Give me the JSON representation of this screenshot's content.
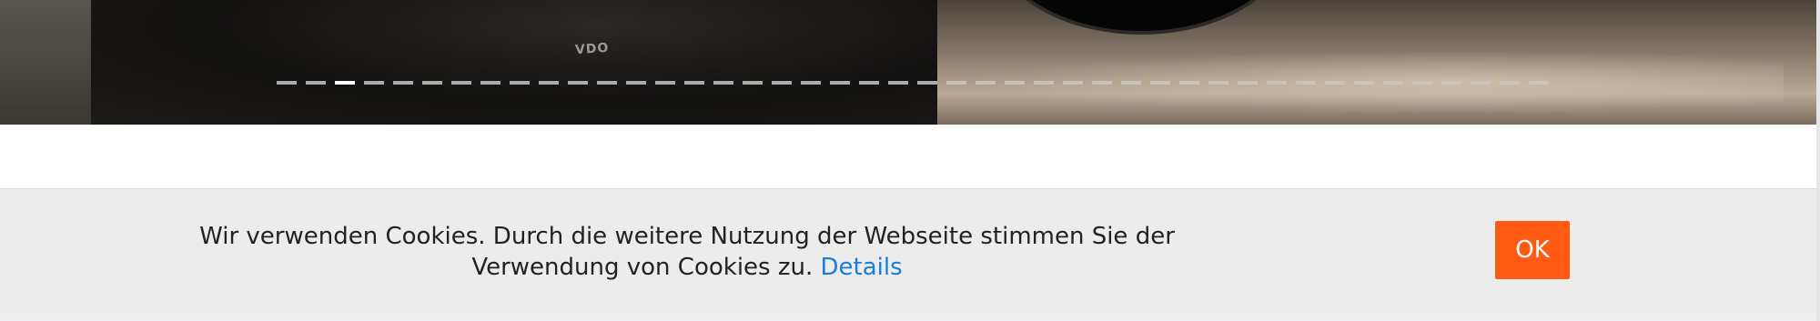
{
  "hero": {
    "logo_text": "VDO",
    "slider": {
      "dot_count": 44,
      "active_index": 2,
      "dot_color": "#c7c7c7",
      "active_color": "#ffffff"
    }
  },
  "cookie_banner": {
    "message": "Wir verwenden Cookies. Durch die weitere Nutzung der Webseite stimmen Sie der Verwendung von Cookies zu.",
    "details_link": "Details",
    "ok_label": "OK",
    "colors": {
      "background": "#ececec",
      "button": "#ff5a14",
      "link": "#1a7be0",
      "text": "#222222"
    }
  }
}
